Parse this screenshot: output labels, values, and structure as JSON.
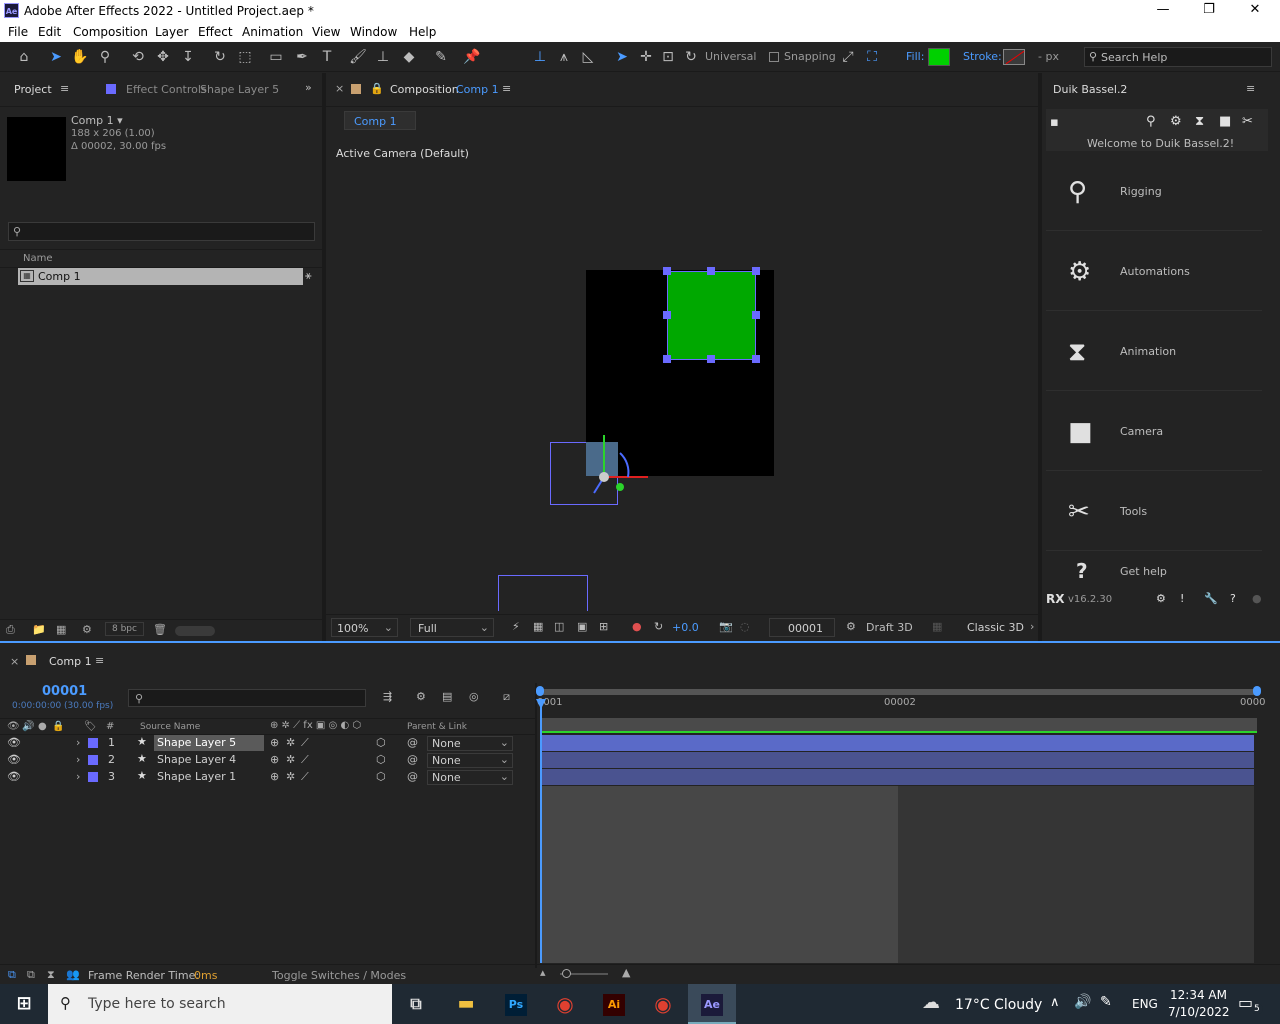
{
  "window": {
    "app_icon": "Ae",
    "title": "Adobe After Effects 2022 - Untitled Project.aep *",
    "minimize": "—",
    "maximize": "❐",
    "close": "✕"
  },
  "menu": [
    "File",
    "Edit",
    "Composition",
    "Layer",
    "Effect",
    "Animation",
    "View",
    "Window",
    "Help"
  ],
  "toolbar": {
    "axis_mode": "Universal",
    "snapping": "Snapping",
    "fill_label": "Fill:",
    "stroke_label": "Stroke:",
    "stroke_unit": "- px",
    "search_placeholder": "Search Help",
    "fill_color": "#00d000"
  },
  "project_panel": {
    "tab_project": "Project",
    "tab_effect_controls": "Effect Controls",
    "effect_controls_layer": "Shape Layer 5",
    "selected_name": "Comp 1 ▾",
    "selected_dims": "188 x 206 (1.00)",
    "selected_duration": "Δ 00002, 30.00 fps",
    "search_placeholder": "",
    "col_name": "Name",
    "items": [
      {
        "name": "Comp 1"
      }
    ],
    "bpc": "8 bpc"
  },
  "composition_panel": {
    "tab_prefix": "Composition",
    "tab_name": "Comp 1",
    "breadcrumb": "Comp 1",
    "camera_label": "Active Camera (Default)",
    "zoom": "100%",
    "resolution": "Full",
    "exposure": "+0.0",
    "frame": "00001",
    "renderer_mode": "Draft 3D",
    "renderer": "Classic 3D"
  },
  "duik_panel": {
    "title": "Duik Bassel.2",
    "welcome": "Welcome to Duik Bassel.2!",
    "items": [
      {
        "label": "Rigging",
        "icon": "rigging-icon"
      },
      {
        "label": "Automations",
        "icon": "automations-icon"
      },
      {
        "label": "Animation",
        "icon": "animation-icon"
      },
      {
        "label": "Camera",
        "icon": "camera-icon"
      },
      {
        "label": "Tools",
        "icon": "tools-icon"
      }
    ],
    "help": "Get help",
    "version": "v16.2.30"
  },
  "timeline": {
    "tab": "Comp 1",
    "timecode": "00001",
    "timecode_sub": "0:00:00:00 (30.00 fps)",
    "col_source_name": "Source Name",
    "col_parent": "Parent & Link",
    "ruler_start": "0001",
    "ruler_mid": "00002",
    "ruler_end": "0000",
    "layers": [
      {
        "num": "1",
        "name": "Shape Layer 5",
        "parent": "None"
      },
      {
        "num": "2",
        "name": "Shape Layer 4",
        "parent": "None"
      },
      {
        "num": "3",
        "name": "Shape Layer 1",
        "parent": "None"
      }
    ],
    "render_time_label": "Frame Render Time:",
    "render_time_value": "0ms",
    "toggle": "Toggle Switches / Modes"
  },
  "taskbar": {
    "search_placeholder": "Type here to search",
    "weather": "17°C  Cloudy",
    "lang": "ENG",
    "time": "12:34 AM",
    "date": "7/10/2022",
    "notifications": "5",
    "apps": [
      "Ps",
      "Ai",
      "Ae"
    ]
  }
}
